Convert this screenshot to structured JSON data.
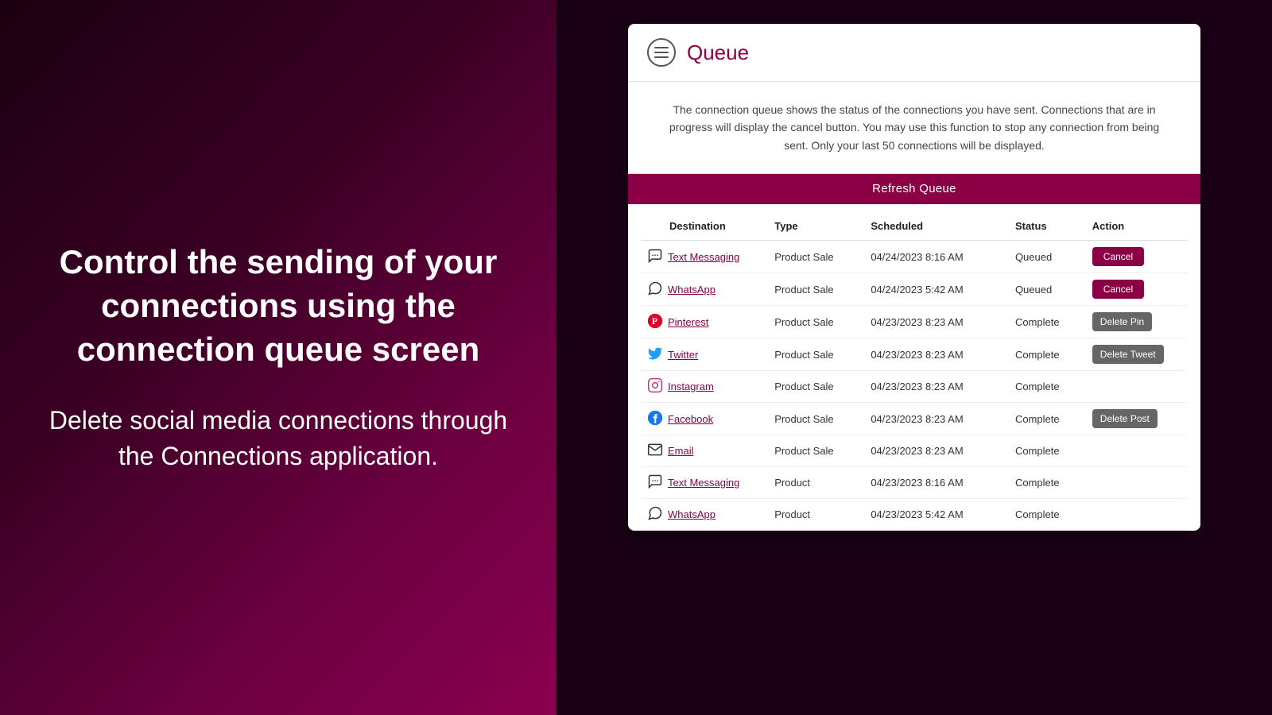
{
  "left": {
    "heading": "Control the sending of your connections using the connection queue screen",
    "subtext": "Delete social media connections through the Connections application."
  },
  "right": {
    "header": {
      "title": "Queue",
      "menu_icon_label": "menu"
    },
    "info_text": "The connection queue shows the status of the connections you have sent. Connections that are in progress will display the cancel button. You may use this function to stop any connection from being sent. Only your last 50 connections will be displayed.",
    "refresh_button": "Refresh Queue",
    "table": {
      "columns": [
        "Destination",
        "Type",
        "Scheduled",
        "Status",
        "Action"
      ],
      "rows": [
        {
          "id": 1,
          "icon": "sms",
          "destination": "Text Messaging",
          "type": "Product Sale",
          "scheduled": "04/24/2023 8:16 AM",
          "status": "Queued",
          "action": "Cancel"
        },
        {
          "id": 2,
          "icon": "whatsapp",
          "destination": "WhatsApp",
          "type": "Product Sale",
          "scheduled": "04/24/2023 5:42 AM",
          "status": "Queued",
          "action": "Cancel"
        },
        {
          "id": 3,
          "icon": "pinterest",
          "destination": "Pinterest",
          "type": "Product Sale",
          "scheduled": "04/23/2023 8:23 AM",
          "status": "Complete",
          "action": "Delete Pin"
        },
        {
          "id": 4,
          "icon": "twitter",
          "destination": "Twitter",
          "type": "Product Sale",
          "scheduled": "04/23/2023 8:23 AM",
          "status": "Complete",
          "action": "Delete Tweet"
        },
        {
          "id": 5,
          "icon": "instagram",
          "destination": "Instagram",
          "type": "Product Sale",
          "scheduled": "04/23/2023 8:23 AM",
          "status": "Complete",
          "action": ""
        },
        {
          "id": 6,
          "icon": "facebook",
          "destination": "Facebook",
          "type": "Product Sale",
          "scheduled": "04/23/2023 8:23 AM",
          "status": "Complete",
          "action": "Delete Post"
        },
        {
          "id": 7,
          "icon": "email",
          "destination": "Email",
          "type": "Product Sale",
          "scheduled": "04/23/2023 8:23 AM",
          "status": "Complete",
          "action": ""
        },
        {
          "id": 8,
          "icon": "sms",
          "destination": "Text Messaging",
          "type": "Product",
          "scheduled": "04/23/2023 8:16 AM",
          "status": "Complete",
          "action": ""
        },
        {
          "id": 9,
          "icon": "whatsapp",
          "destination": "WhatsApp",
          "type": "Product",
          "scheduled": "04/23/2023 5:42 AM",
          "status": "Complete",
          "action": ""
        }
      ]
    }
  }
}
